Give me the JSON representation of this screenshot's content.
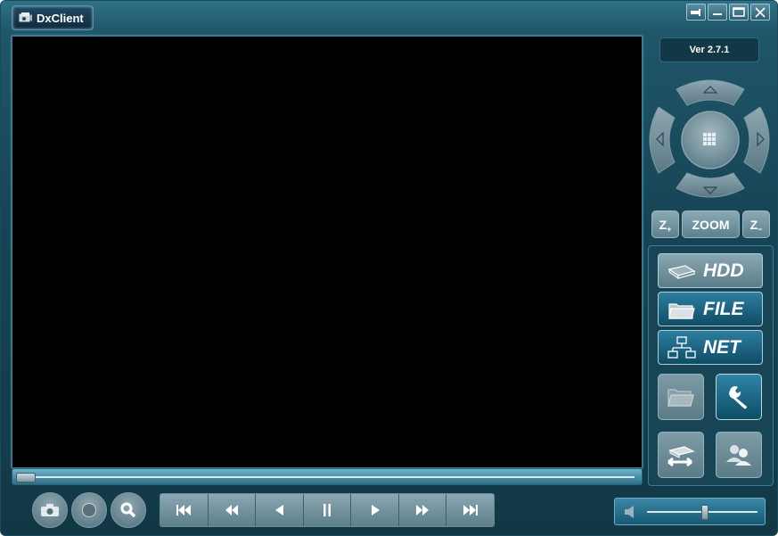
{
  "window": {
    "title": "DxClient",
    "controls": [
      "pin-icon",
      "minimize-icon",
      "maximize-icon",
      "close-icon"
    ]
  },
  "version": "Ver 2.7.1",
  "zoom": {
    "in_label": "Z",
    "center_label": "ZOOM",
    "out_label": "Z"
  },
  "modes": [
    {
      "label": "HDD",
      "icon": "hdd-icon"
    },
    {
      "label": "FILE",
      "icon": "folder-icon"
    },
    {
      "label": "NET",
      "icon": "network-icon"
    }
  ],
  "tools": [
    "open-folder-icon",
    "wrench-icon",
    "convert-icon",
    "users-icon"
  ],
  "bottom": {
    "circle_buttons": [
      "camera-icon",
      "record-icon",
      "search-icon"
    ],
    "transport": [
      "first-frame-icon",
      "fast-backward-icon",
      "play-backward-icon",
      "pause-icon",
      "play-icon",
      "fast-forward-icon",
      "last-frame-icon"
    ],
    "volume_level": 0.52
  },
  "colors": {
    "accent": "#2d7ea0",
    "background": "#174556"
  }
}
